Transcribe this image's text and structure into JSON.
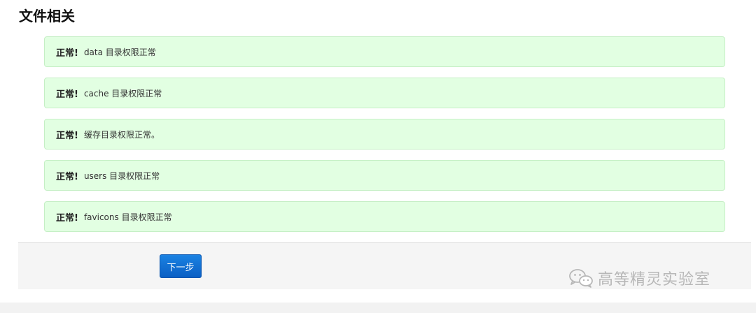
{
  "section": {
    "title": "文件相关"
  },
  "alerts": [
    {
      "strong": "正常!",
      "message": "data 目录权限正常"
    },
    {
      "strong": "正常!",
      "message": "cache 目录权限正常"
    },
    {
      "strong": "正常!",
      "message": "缓存目录权限正常。"
    },
    {
      "strong": "正常!",
      "message": "users 目录权限正常"
    },
    {
      "strong": "正常!",
      "message": "favicons 目录权限正常"
    }
  ],
  "footer": {
    "next_label": "下一步"
  },
  "watermark": {
    "icon": "wechat-icon",
    "text": "高等精灵实验室"
  },
  "colors": {
    "alert_bg": "#e2ffe2",
    "alert_border": "#c5efc5",
    "button_primary": "#1a74d6",
    "footer_bg": "#f5f5f5"
  }
}
